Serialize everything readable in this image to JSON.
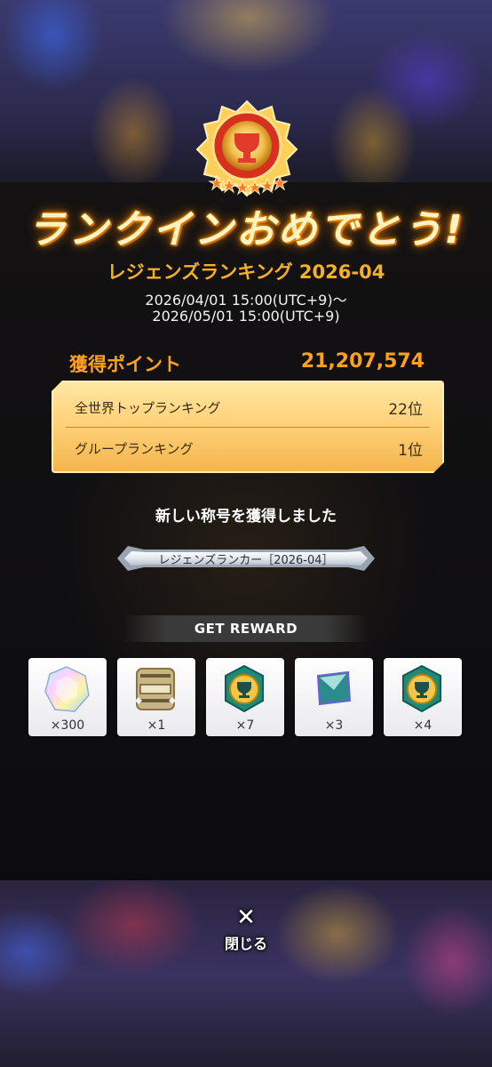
{
  "headline": "ランクインおめでとう!",
  "event": {
    "title": "レジェンズランキング 2026-04",
    "period_start": "2026/04/01 15:00(UTC+9)〜",
    "period_end": "2026/05/01 15:00(UTC+9)"
  },
  "points": {
    "label": "獲得ポイント",
    "value": "21,207,574"
  },
  "rankings": [
    {
      "label": "全世界トップランキング",
      "rank": "22位"
    },
    {
      "label": "グループランキング",
      "rank": "1位"
    }
  ],
  "new_title": {
    "message": "新しい称号を獲得しました",
    "name": "レジェンズランカー［2026-04］"
  },
  "rewards": {
    "header": "GET REWARD",
    "items": [
      {
        "icon": "rainbow-gem-icon",
        "qty": "×300"
      },
      {
        "icon": "ticket-plate-icon",
        "qty": "×1"
      },
      {
        "icon": "trophy-medal-icon",
        "qty": "×7"
      },
      {
        "icon": "crystal-card-icon",
        "qty": "×3"
      },
      {
        "icon": "trophy-medal-icon",
        "qty": "×4"
      }
    ]
  },
  "close": {
    "label": "閉じる",
    "icon": "close-x-icon"
  },
  "colors": {
    "accent": "#ffa21a",
    "title": "#f7b021",
    "panel": "#ffd27a"
  }
}
